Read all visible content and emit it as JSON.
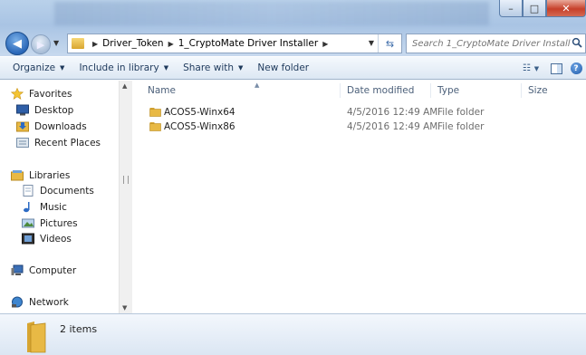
{
  "window": {
    "minimize_label": "–",
    "maximize_label": "□",
    "close_label": "✕"
  },
  "address_bar": {
    "breadcrumbs": [
      "Driver_Token",
      "1_CryptoMate Driver Installer"
    ]
  },
  "search": {
    "placeholder": "Search 1_CryptoMate Driver Installer"
  },
  "command_bar": {
    "organize": "Organize",
    "include_in_library": "Include in library",
    "share_with": "Share with",
    "new_folder": "New folder"
  },
  "nav": {
    "favorites": "Favorites",
    "desktop": "Desktop",
    "downloads": "Downloads",
    "recent_places": "Recent Places",
    "libraries": "Libraries",
    "documents": "Documents",
    "music": "Music",
    "pictures": "Pictures",
    "videos": "Videos",
    "computer": "Computer",
    "network": "Network"
  },
  "columns": {
    "name": "Name",
    "date_modified": "Date modified",
    "type": "Type",
    "size": "Size"
  },
  "files": [
    {
      "name": "ACOS5-Winx64",
      "date": "4/5/2016 12:49 AM",
      "type": "File folder"
    },
    {
      "name": "ACOS5-Winx86",
      "date": "4/5/2016 12:49 AM",
      "type": "File folder"
    }
  ],
  "status": {
    "item_count": "2 items"
  },
  "colors": {
    "folder": "#e8b945",
    "accent": "#1e395b"
  }
}
